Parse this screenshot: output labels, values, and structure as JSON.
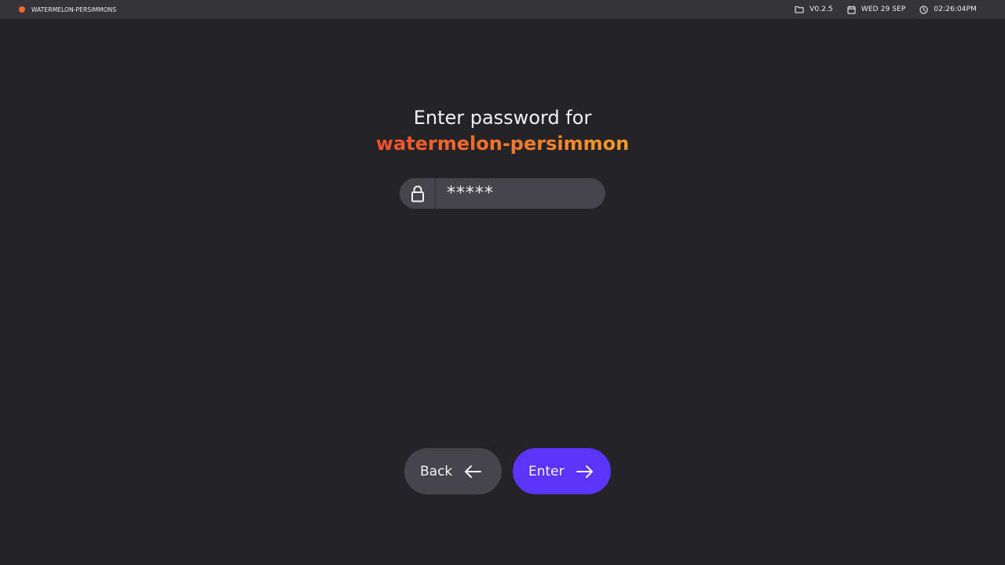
{
  "topbar": {
    "device_name": "WATERMELON-PERSIMMONS",
    "version": "V0.2.5",
    "date": "WED 29 SEP",
    "time": "02:26:04PM",
    "icons": {
      "status_dot": "status-dot",
      "version": "folder-icon",
      "date": "calendar-icon",
      "time": "clock-icon"
    }
  },
  "prompt": {
    "line1": "Enter password for",
    "network_name": "watermelon-persimmon"
  },
  "password": {
    "value": "*****",
    "icon": "lock-icon"
  },
  "buttons": {
    "back_label": "Back",
    "back_icon": "arrow-left-icon",
    "enter_label": "Enter",
    "enter_icon": "arrow-right-icon"
  },
  "colors": {
    "background": "#242328",
    "topbar": "#353439",
    "accent_gradient_start": "#f4502c",
    "accent_gradient_end": "#f89a2a",
    "status_dot": "#f26a2a",
    "primary_button": "#5a34f8",
    "secondary_button": "#46454b"
  }
}
